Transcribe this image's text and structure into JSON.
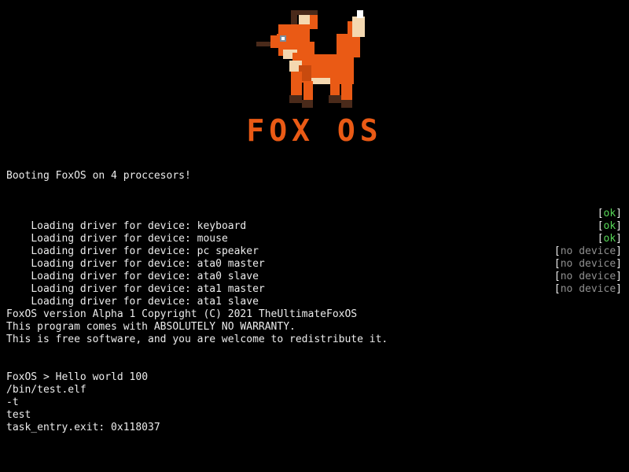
{
  "logo": {
    "wordmark": "FOX OS",
    "colors": {
      "orange": "#ea5a15",
      "dark_orange": "#c84a0e",
      "cream": "#f4d8b0",
      "white": "#ffffff",
      "brown": "#4a2a1a",
      "eye": "#7a8c9c"
    }
  },
  "boot_message": "Booting FoxOS on 4 proccesors!",
  "drivers": [
    {
      "label": "Loading driver for device: keyboard",
      "status": "ok",
      "kind": "ok"
    },
    {
      "label": "Loading driver for device: mouse",
      "status": "ok",
      "kind": "ok"
    },
    {
      "label": "Loading driver for device: pc speaker",
      "status": "ok",
      "kind": "ok"
    },
    {
      "label": "Loading driver for device: ata0 master",
      "status": "no device",
      "kind": "none"
    },
    {
      "label": "Loading driver for device: ata0 slave",
      "status": "no device",
      "kind": "none"
    },
    {
      "label": "Loading driver for device: ata1 master",
      "status": "no device",
      "kind": "none"
    },
    {
      "label": "Loading driver for device: ata1 slave",
      "status": "no device",
      "kind": "none"
    }
  ],
  "info": [
    "FoxOS version Alpha 1 Copyright (C) 2021 TheUltimateFoxOS",
    "This program comes with ABSOLUTELY NO WARRANTY.",
    "This is free software, and you are welcome to redistribute it."
  ],
  "shell": {
    "prompt": "FoxOS > ",
    "command": "Hello world 100",
    "output": [
      "/bin/test.elf",
      "-t",
      "test",
      "task_entry.exit: 0x118037"
    ]
  },
  "colors": {
    "background": "#000000",
    "text": "#ececec",
    "ok": "#57d657",
    "no_device": "#8f8f8f",
    "brand": "#ea5a15"
  }
}
